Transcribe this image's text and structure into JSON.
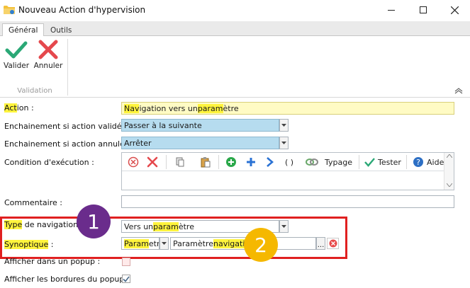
{
  "window": {
    "title": "Nouveau Action d'hypervision",
    "minimize_glyph": "—",
    "maximize_glyph": "☐",
    "close_glyph": "✕"
  },
  "ribbon": {
    "tabs": [
      {
        "label": "Général",
        "active": true
      },
      {
        "label": "Outils",
        "active": false
      }
    ],
    "buttons": {
      "validate_label": "Valider",
      "cancel_label": "Annuler"
    },
    "group_label": "Validation"
  },
  "form": {
    "action": {
      "label_hl": "Act",
      "label_rest": "ion :",
      "value_p1": "Nav",
      "value_p2": "igation vers un ",
      "value_p3": "param",
      "value_p4": "ètre"
    },
    "on_validated": {
      "label": "Enchainement si action validée :",
      "value": "Passer à la suivante"
    },
    "on_cancelled": {
      "label": "Enchainement si action annulée :",
      "value": "Arrêter"
    },
    "condition": {
      "label": "Condition d'exécution :",
      "typage_label": "Typage",
      "tester_label": "Tester",
      "aide_label": "Aide",
      "parens_label": "( )"
    },
    "comment": {
      "label": "Commentaire :",
      "value": ""
    },
    "nav_type": {
      "label_hl": "Type",
      "label_rest": " de navigation :",
      "value_p1": "Vers un ",
      "value_p2": "param",
      "value_p3": "ètre"
    },
    "synoptic": {
      "label_hl": "Synoptique",
      "label_rest": " :",
      "type_hl": "Param",
      "type_rest": "etre",
      "value_p1": "Paramètre ",
      "value_p2": "navigation",
      "browse_label": "..."
    },
    "show_popup": {
      "label": "Afficher dans un popup :",
      "checked": false
    },
    "popup_borders": {
      "label": "Afficher les bordures du popup :",
      "checked": true
    }
  },
  "callouts": {
    "one": "1",
    "two": "2",
    "one_color": "#6a2c8c",
    "two_color": "#f5b800",
    "highlight_color": "#e02020"
  }
}
